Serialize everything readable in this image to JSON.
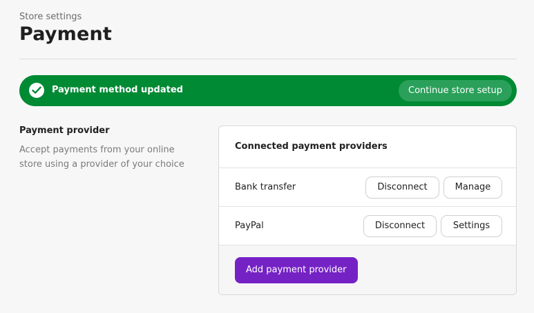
{
  "header": {
    "breadcrumb": "Store settings",
    "title": "Payment"
  },
  "banner": {
    "message": "Payment method updated",
    "action_label": "Continue store setup",
    "icon": "check-circle-icon",
    "color": "#008a33"
  },
  "section": {
    "title": "Payment provider",
    "description": "Accept payments from your online store using a provider of your choice"
  },
  "card": {
    "title": "Connected payment providers",
    "providers": [
      {
        "name": "Bank transfer",
        "actions": [
          "Disconnect",
          "Manage"
        ]
      },
      {
        "name": "PayPal",
        "actions": [
          "Disconnect",
          "Settings"
        ]
      }
    ],
    "add_label": "Add payment provider",
    "add_color": "#7522c5"
  }
}
